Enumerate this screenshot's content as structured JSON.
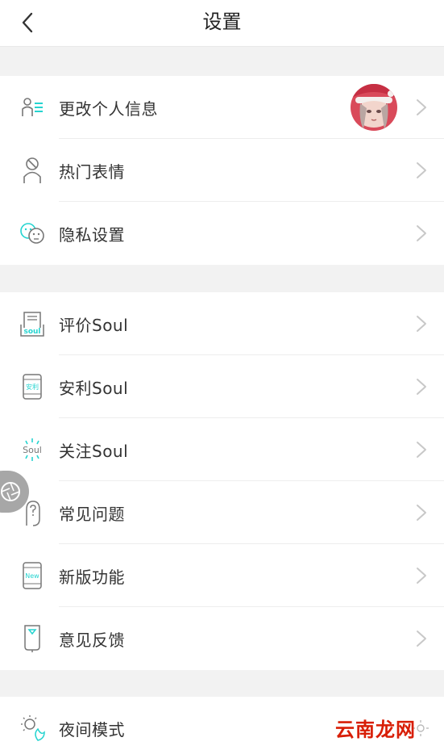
{
  "header": {
    "title": "设置"
  },
  "colors": {
    "accent": "#25d4d0",
    "icon_gray": "#777777",
    "chevron": "#c8c8c8",
    "watermark": "#d81e06"
  },
  "groups": [
    {
      "items": [
        {
          "label": "更改个人信息",
          "icon": "profile-list-icon",
          "has_avatar": true
        },
        {
          "label": "热门表情",
          "icon": "person-slash-icon"
        },
        {
          "label": "隐私设置",
          "icon": "faces-privacy-icon"
        }
      ]
    },
    {
      "items": [
        {
          "label": "评价Soul",
          "icon": "rate-soul-icon",
          "icon_text": "soul"
        },
        {
          "label": "安利Soul",
          "icon": "phone-share-icon",
          "icon_text": "安利"
        },
        {
          "label": "关注Soul",
          "icon": "soul-sun-icon",
          "icon_text": "Soul"
        },
        {
          "label": "常见问题",
          "icon": "question-hand-icon"
        },
        {
          "label": "新版功能",
          "icon": "phone-new-icon",
          "icon_text": "New"
        },
        {
          "label": "意见反馈",
          "icon": "feedback-phone-icon"
        }
      ]
    },
    {
      "items": [
        {
          "label": "夜间模式",
          "icon": "night-mode-icon"
        }
      ]
    }
  ],
  "watermark": {
    "text": "云南龙网"
  }
}
